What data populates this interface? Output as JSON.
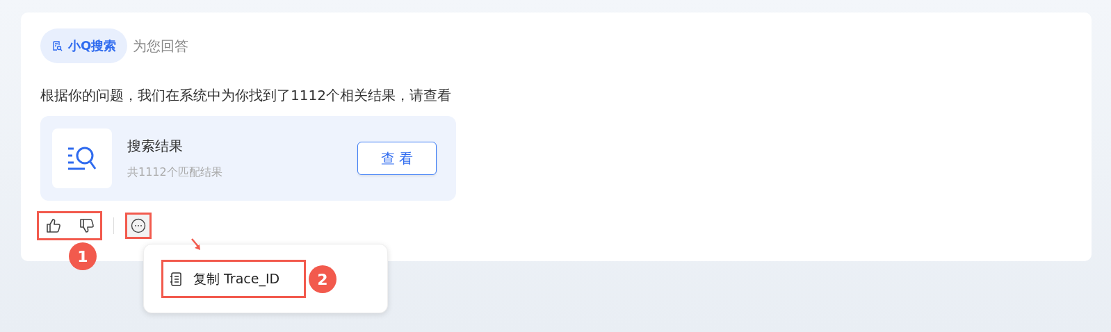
{
  "header": {
    "badge": "小Q搜索",
    "suffix": "为您回答"
  },
  "message": "根据你的问题，我们在系统中为你找到了1112个相关结果，请查看",
  "result_card": {
    "title": "搜索结果",
    "subtitle": "共1112个匹配结果",
    "button": "查 看"
  },
  "feedback": [
    {
      "kind": "like"
    },
    {
      "kind": "dislike"
    }
  ],
  "more_menu": {
    "items": [
      {
        "label": "复制 Trace_ID"
      }
    ]
  },
  "annotations": [
    {
      "label": "1"
    },
    {
      "label": "2"
    }
  ]
}
